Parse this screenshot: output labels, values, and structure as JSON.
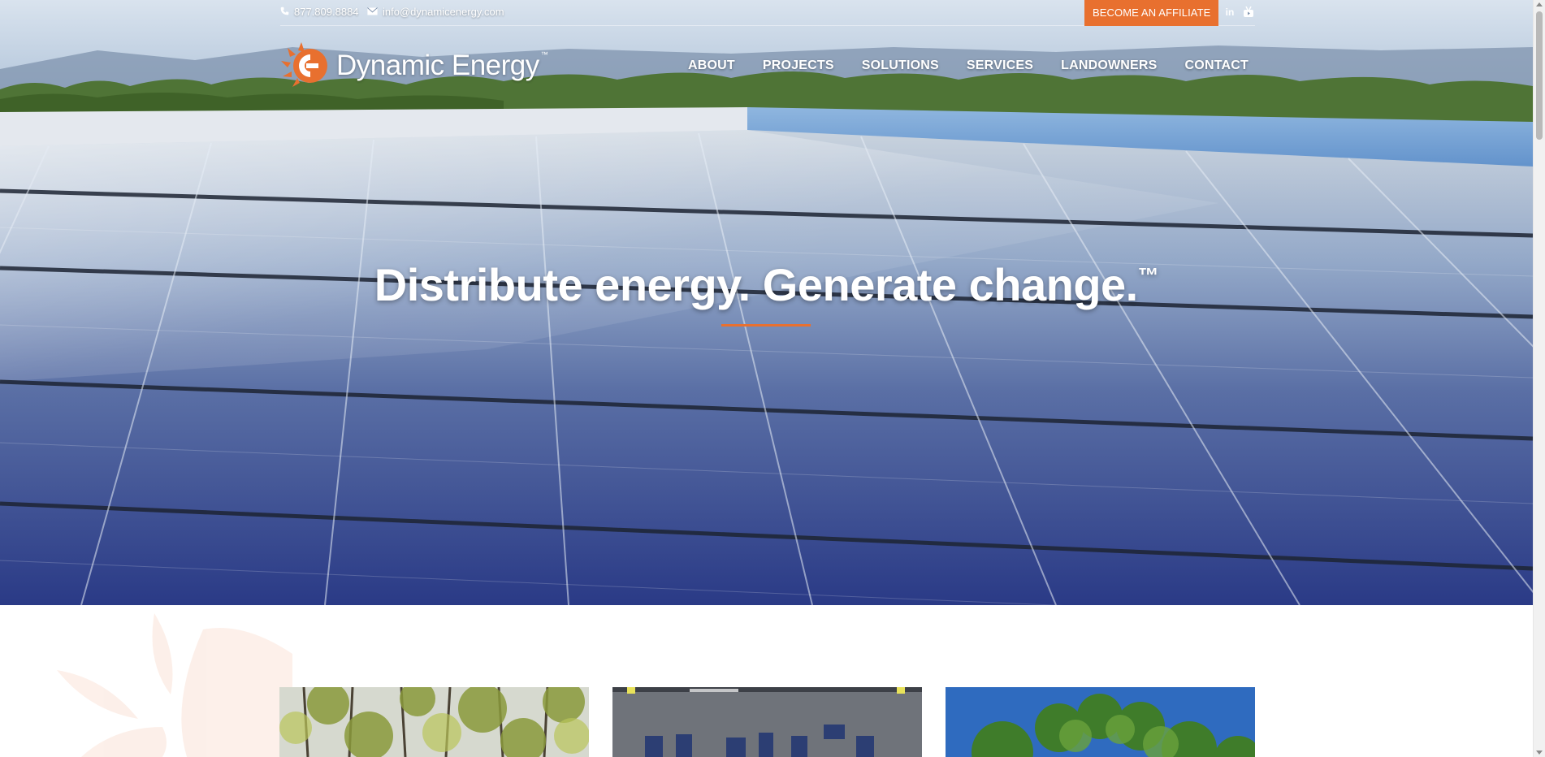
{
  "topbar": {
    "phone": "877.809.8884",
    "email": "info@dynamicenergy.com",
    "affiliate_button": "BECOME AN AFFILIATE",
    "social": [
      {
        "icon": "linkedin-icon",
        "glyph": "in"
      },
      {
        "icon": "youtube-icon",
        "glyph": "▶"
      }
    ]
  },
  "brand": {
    "name": "Dynamic Energy",
    "trademark": "™",
    "accent_color": "#e8702f"
  },
  "nav": {
    "items": [
      "ABOUT",
      "PROJECTS",
      "SOLUTIONS",
      "SERVICES",
      "LANDOWNERS",
      "CONTACT"
    ]
  },
  "hero": {
    "headline": "Distribute energy. Generate change.",
    "headline_mark": "™",
    "background": "solar-panels-rooftop"
  },
  "cards": [
    {
      "image": "trees-field-photo"
    },
    {
      "image": "rooftop-solar-photo"
    },
    {
      "image": "green-trees-sky-photo"
    }
  ]
}
